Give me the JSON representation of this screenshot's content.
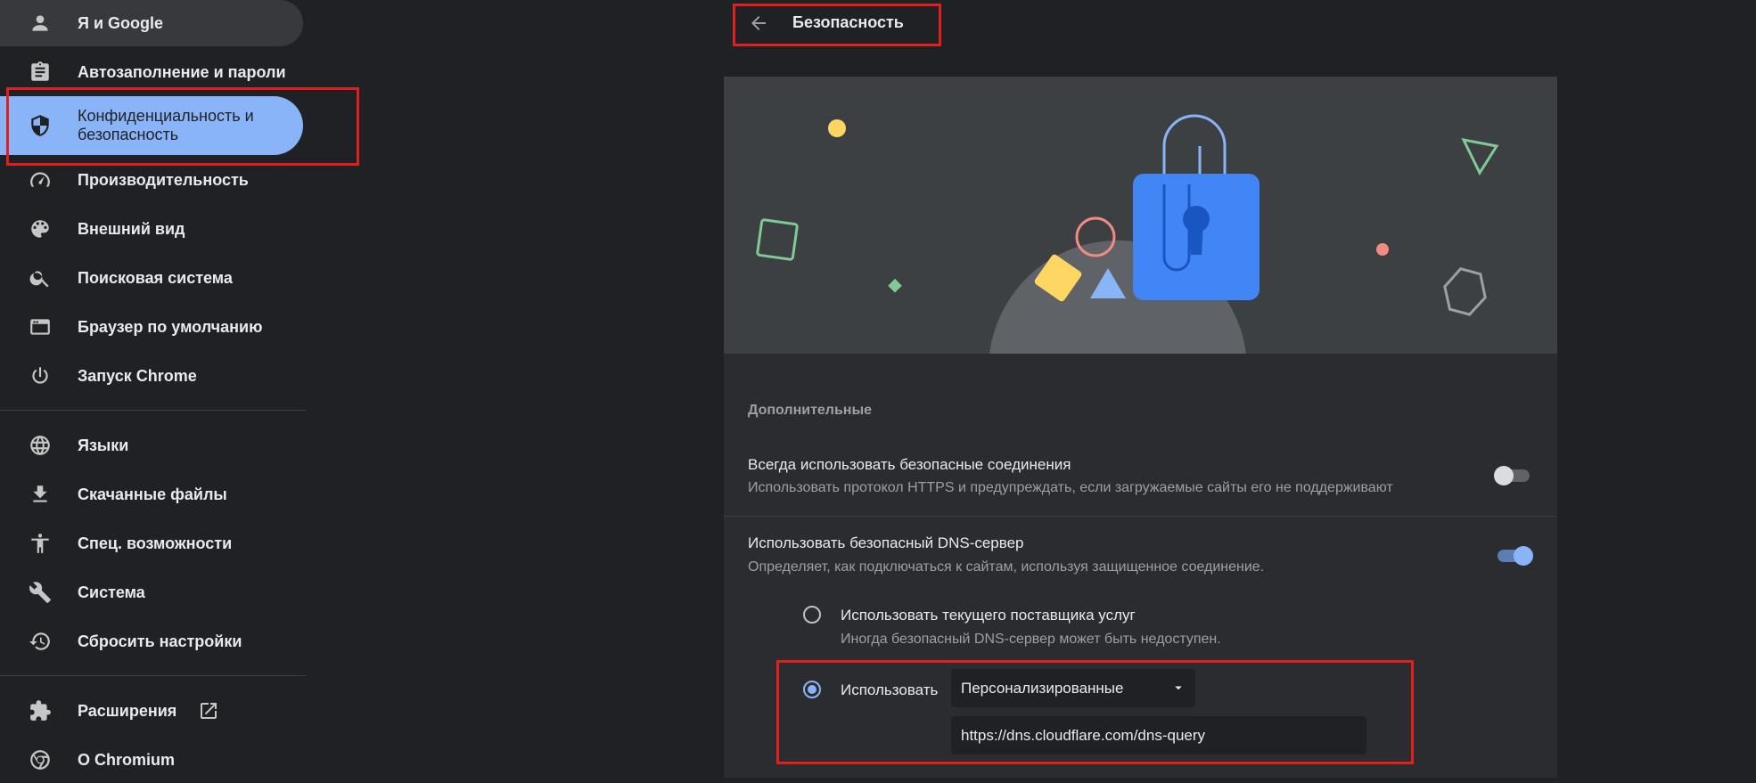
{
  "sidebar": {
    "items": [
      {
        "label": "Я и Google",
        "icon": "person-icon"
      },
      {
        "label": "Автозаполнение и пароли",
        "icon": "clipboard-icon"
      },
      {
        "label": "Конфиденциальность и безопасность",
        "icon": "shield-icon"
      },
      {
        "label": "Производительность",
        "icon": "speedometer-icon"
      },
      {
        "label": "Внешний вид",
        "icon": "palette-icon"
      },
      {
        "label": "Поисковая система",
        "icon": "search-icon"
      },
      {
        "label": "Браузер по умолчанию",
        "icon": "browser-window-icon"
      },
      {
        "label": "Запуск Chrome",
        "icon": "power-icon"
      },
      {
        "label": "Языки",
        "icon": "globe-icon"
      },
      {
        "label": "Скачанные файлы",
        "icon": "download-icon"
      },
      {
        "label": "Спец. возможности",
        "icon": "accessibility-icon"
      },
      {
        "label": "Система",
        "icon": "wrench-icon"
      },
      {
        "label": "Сбросить настройки",
        "icon": "restore-icon"
      },
      {
        "label": "Расширения",
        "icon": "puzzle-icon"
      },
      {
        "label": "О Chromium",
        "icon": "chromium-logo-icon"
      }
    ],
    "active_index": 2
  },
  "header": {
    "title": "Безопасность"
  },
  "advanced": {
    "section_title": "Дополнительные",
    "https": {
      "title": "Всегда использовать безопасные соединения",
      "subtitle": "Использовать протокол HTTPS и предупреждать, если загружаемые сайты его не поддерживают",
      "enabled": false
    },
    "secure_dns": {
      "title": "Использовать безопасный DNS-сервер",
      "subtitle": "Определяет, как подключаться к сайтам, используя защищенное соединение.",
      "enabled": true,
      "option_current": {
        "title": "Использовать текущего поставщика услуг",
        "subtitle": "Иногда безопасный DNS-сервер может быть недоступен.",
        "selected": false
      },
      "option_custom": {
        "label": "Использовать",
        "selected": true,
        "provider_selected": "Персонализированные",
        "custom_url": "https://dns.cloudflare.com/dns-query"
      }
    }
  },
  "colors": {
    "background": "#202124",
    "card": "#2b2c2f",
    "accent": "#8ab4f8",
    "highlight_box": "#e01f1f"
  }
}
